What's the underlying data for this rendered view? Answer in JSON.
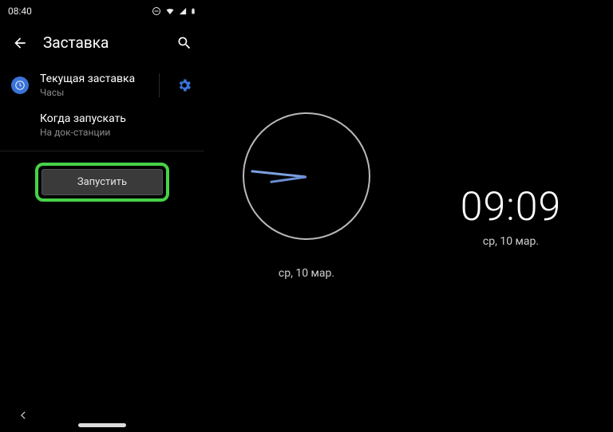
{
  "statusbar": {
    "time": "08:40"
  },
  "header": {
    "title": "Заставка"
  },
  "row_current": {
    "title": "Текущая заставка",
    "subtitle": "Часы"
  },
  "row_when": {
    "title": "Когда запускать",
    "subtitle": "На док-станции"
  },
  "launch": {
    "label": "Запустить"
  },
  "analog": {
    "date": "ср, 10 мар."
  },
  "digital": {
    "time": "09:09",
    "date": "ср, 10 мар."
  }
}
